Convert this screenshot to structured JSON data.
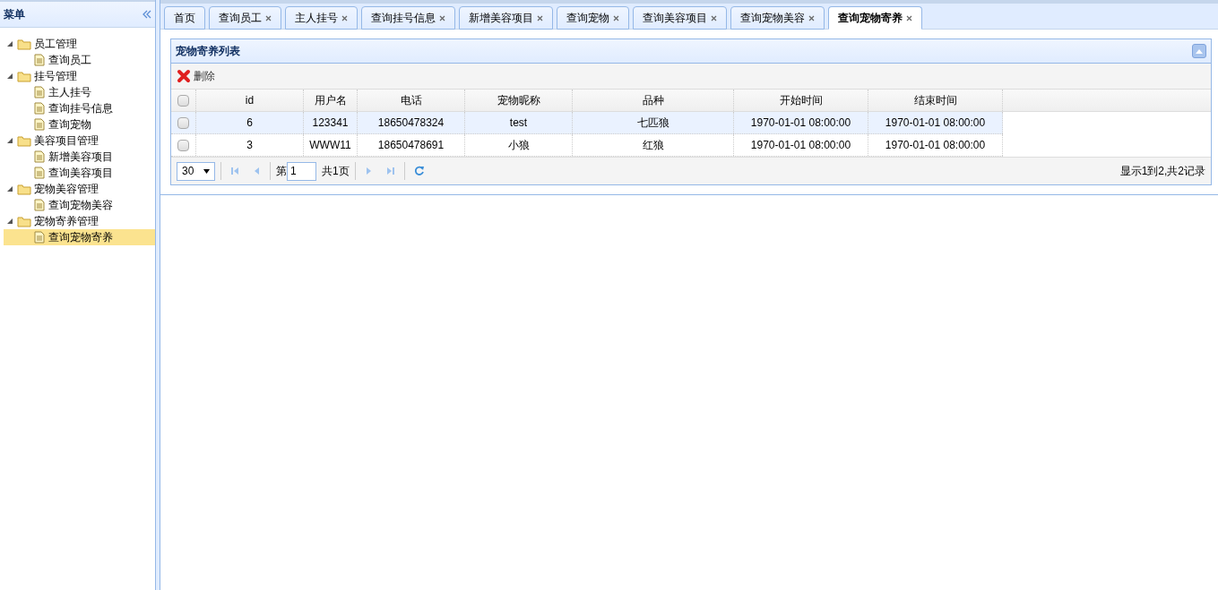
{
  "sidebar": {
    "title": "菜单",
    "tree": [
      {
        "label": "员工管理",
        "expanded": true,
        "children": [
          {
            "label": "查询员工",
            "selected": false
          }
        ]
      },
      {
        "label": "挂号管理",
        "expanded": true,
        "children": [
          {
            "label": "主人挂号",
            "selected": false
          },
          {
            "label": "查询挂号信息",
            "selected": false
          },
          {
            "label": "查询宠物",
            "selected": false
          }
        ]
      },
      {
        "label": "美容项目管理",
        "expanded": true,
        "children": [
          {
            "label": "新增美容项目",
            "selected": false
          },
          {
            "label": "查询美容项目",
            "selected": false
          }
        ]
      },
      {
        "label": "宠物美容管理",
        "expanded": true,
        "children": [
          {
            "label": "查询宠物美容",
            "selected": false
          }
        ]
      },
      {
        "label": "宠物寄养管理",
        "expanded": true,
        "children": [
          {
            "label": "查询宠物寄养",
            "selected": true
          }
        ]
      }
    ]
  },
  "tabs": [
    {
      "label": "首页",
      "closable": false,
      "selected": false
    },
    {
      "label": "查询员工",
      "closable": true,
      "selected": false
    },
    {
      "label": "主人挂号",
      "closable": true,
      "selected": false
    },
    {
      "label": "查询挂号信息",
      "closable": true,
      "selected": false
    },
    {
      "label": "新增美容项目",
      "closable": true,
      "selected": false
    },
    {
      "label": "查询宠物",
      "closable": true,
      "selected": false
    },
    {
      "label": "查询美容项目",
      "closable": true,
      "selected": false
    },
    {
      "label": "查询宠物美容",
      "closable": true,
      "selected": false
    },
    {
      "label": "查询宠物寄养",
      "closable": true,
      "selected": true
    }
  ],
  "panel": {
    "title": "宠物寄养列表",
    "toolbar": [
      {
        "label": "删除"
      }
    ],
    "table": {
      "all_checked": false,
      "columns": [
        "id",
        "用户名",
        "电话",
        "宠物昵称",
        "品种",
        "开始时间",
        "结束时间"
      ],
      "rows": [
        {
          "selected": true,
          "checked": false,
          "cells": [
            "6",
            "123341",
            "18650478324",
            "test",
            "七匹狼",
            "1970-01-01 08:00:00",
            "1970-01-01 08:00:00"
          ]
        },
        {
          "selected": false,
          "checked": false,
          "cells": [
            "3",
            "WWW11",
            "18650478691",
            "小狼",
            "红狼",
            "1970-01-01 08:00:00",
            "1970-01-01 08:00:00"
          ]
        }
      ]
    },
    "pager": {
      "page_size": "30",
      "page_label": "第",
      "page": "1",
      "total_pages": "共1页",
      "summary": "显示1到2,共2记录"
    }
  }
}
